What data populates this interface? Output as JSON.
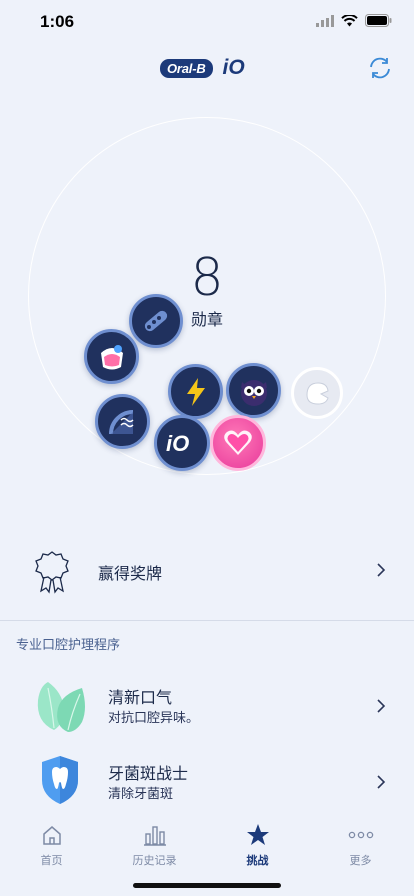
{
  "status_bar": {
    "time": "1:06"
  },
  "header": {
    "brand": "Oral-B",
    "product": "iO"
  },
  "badges": {
    "count": "8",
    "label": "勋章"
  },
  "award": {
    "title": "赢得奖牌"
  },
  "section_title": "专业口腔护理程序",
  "programs": [
    {
      "title": "清新口气",
      "subtitle": "对抗口腔异味。"
    },
    {
      "title": "牙菌斑战士",
      "subtitle": "清除牙菌斑"
    }
  ],
  "tabs": [
    {
      "label": "首页",
      "icon": "home-icon"
    },
    {
      "label": "历史记录",
      "icon": "bar-chart-icon"
    },
    {
      "label": "挑战",
      "icon": "star-icon",
      "active": true
    },
    {
      "label": "更多",
      "icon": "more-dots-icon"
    }
  ],
  "colors": {
    "accent": "#1c3a7a",
    "background": "#eef2fa",
    "pink_medal": "#e8389a"
  }
}
